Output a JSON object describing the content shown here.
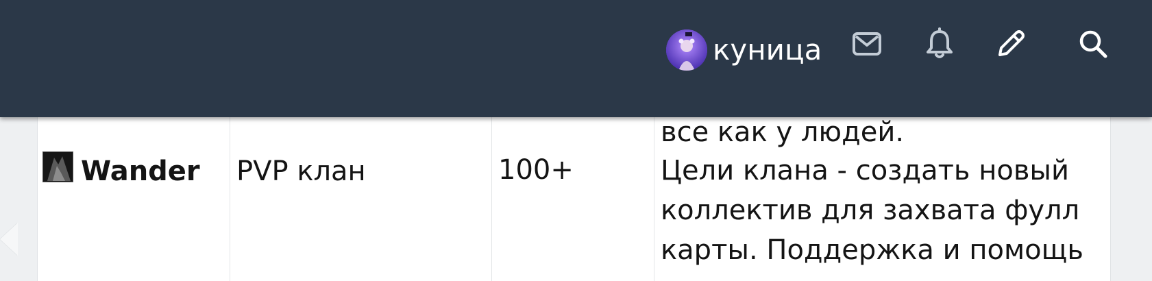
{
  "header": {
    "username": "куница",
    "icons": {
      "messages": "envelope-icon",
      "alerts": "bell-icon",
      "new_post": "pencil-icon",
      "search": "search-icon"
    },
    "colors": {
      "bar": "#2b3848",
      "icon": "#c3ccd6",
      "avatar_bg": "#6a4bd8"
    }
  },
  "table": {
    "rows": [
      {
        "clan_name": "Wander",
        "clan_type": "PVP клан",
        "members": "100+",
        "description_lines": [
          "все как у людей.",
          "Цели клана - создать новый",
          "коллектив для захвата фулл",
          "карты. Поддержка и помощь"
        ]
      }
    ]
  }
}
